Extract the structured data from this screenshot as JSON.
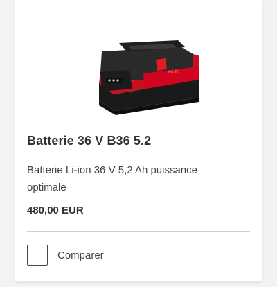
{
  "product": {
    "image_icon": "battery-pack-image",
    "title": "Batterie 36 V B36 5.2",
    "description": "Batterie Li-ion 36 V 5,2 Ah puissance optimale",
    "price": "480,00 EUR",
    "compare_label": "Comparer",
    "compare_checked": false
  },
  "colors": {
    "accent": "#d2051e",
    "text_dark": "#333333",
    "text_body": "#444444",
    "divider": "#cfcfcf"
  }
}
